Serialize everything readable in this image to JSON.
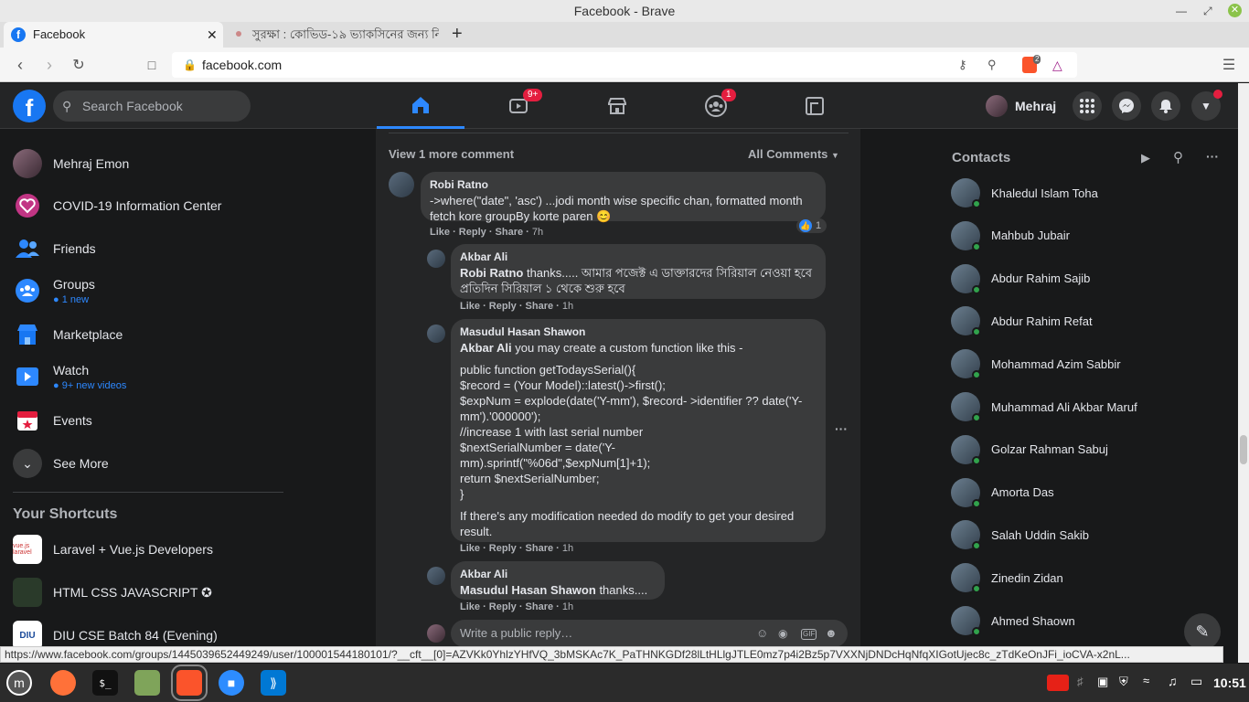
{
  "window": {
    "title": "Facebook - Brave"
  },
  "tabs": [
    {
      "label": "Facebook"
    },
    {
      "label": "সুরক্ষা : কোভিড-১৯ ভ্যাকসিনের জন্য নিবন্ধন"
    }
  ],
  "address": {
    "url": "facebook.com"
  },
  "brave": {
    "shield_count": "2"
  },
  "fb": {
    "search_placeholder": "Search Facebook",
    "watch_badge": "9+",
    "groups_badge": "1",
    "profile_name": "Mehraj"
  },
  "left_nav": {
    "items": [
      {
        "label": "Mehraj Emon",
        "sub": ""
      },
      {
        "label": "COVID-19 Information Center",
        "sub": ""
      },
      {
        "label": "Friends",
        "sub": ""
      },
      {
        "label": "Groups",
        "sub": "1 new"
      },
      {
        "label": "Marketplace",
        "sub": ""
      },
      {
        "label": "Watch",
        "sub": "9+ new videos"
      },
      {
        "label": "Events",
        "sub": ""
      },
      {
        "label": "See More",
        "sub": ""
      }
    ],
    "shortcuts_title": "Your Shortcuts",
    "shortcuts": [
      {
        "label": "Laravel + Vue.js Developers"
      },
      {
        "label": "HTML CSS JAVASCRIPT ✪"
      },
      {
        "label": "DIU CSE Batch 84 (Evening)"
      }
    ]
  },
  "feed": {
    "view_more": "View 1 more comment",
    "filter": "All Comments",
    "comments": [
      {
        "author": "Robi Ratno",
        "mention": "",
        "text": "->where(\"date\", 'asc') ...jodi month wise specific chan, formatted month fetch kore groupBy korte paren 😊",
        "time": "7h",
        "reactions": "1"
      },
      {
        "author": "Akbar Ali",
        "mention": "Robi Ratno",
        "text": "thanks..... আমার পজেক্ট এ ডাক্তারদের সিরিয়াল নেওয়া হবে প্রতিদিন সিরিয়াল ১ থেকে শুরু হবে",
        "time": "1h"
      },
      {
        "author": "Masudul Hasan Shawon",
        "mention": "Akbar Ali",
        "text": "you may create a custom function like this -",
        "code": [
          "public function getTodaysSerial(){",
          "$record = (Your Model)::latest()->first();",
          "$expNum = explode(date('Y-mm'), $record- >identifier ?? date('Y-mm').'000000');",
          "//increase 1 with last serial number",
          "$nextSerialNumber = date('Y-mm).sprintf(\"%06d\",$expNum[1]+1);",
          "return $nextSerialNumber;",
          "}"
        ],
        "footer": "If there's any modification needed do modify to get your desired result.",
        "time": "1h"
      },
      {
        "author": "Akbar Ali",
        "mention": "Masudul Hasan Shawon",
        "text": "thanks....",
        "time": "1h"
      }
    ],
    "actions": {
      "like": "Like",
      "reply": "Reply",
      "share": "Share"
    },
    "reply_placeholder": "Write a public reply…"
  },
  "contacts": {
    "title": "Contacts",
    "people": [
      "Khaledul Islam Toha",
      "Mahbub Jubair",
      "Abdur Rahim Sajib",
      "Abdur Rahim Refat",
      "Mohammad Azim Sabbir",
      "Muhammad Ali Akbar Maruf",
      "Golzar Rahman Sabuj",
      "Amorta Das",
      "Salah Uddin Sakib",
      "Zinedin Zidan",
      "Ahmed Shaown"
    ]
  },
  "statusbar": {
    "url": "https://www.facebook.com/groups/1445039652449249/user/100001544180101/?__cft__[0]=AZVKk0YhlzYHfVQ_3bMSKAc7K_PaTHNKGDf28lLtHLlgJTLE0mz7p4i2Bz5p7VXXNjDNDcHqNfqXIGotUjec8c_zTdKeOnJFi_ioCVA-x2nL..."
  },
  "taskbar": {
    "clock": "10:51"
  },
  "colors": {
    "fb_blue": "#1877f2",
    "badge_red": "#e41e3f",
    "online_green": "#31a24c"
  }
}
